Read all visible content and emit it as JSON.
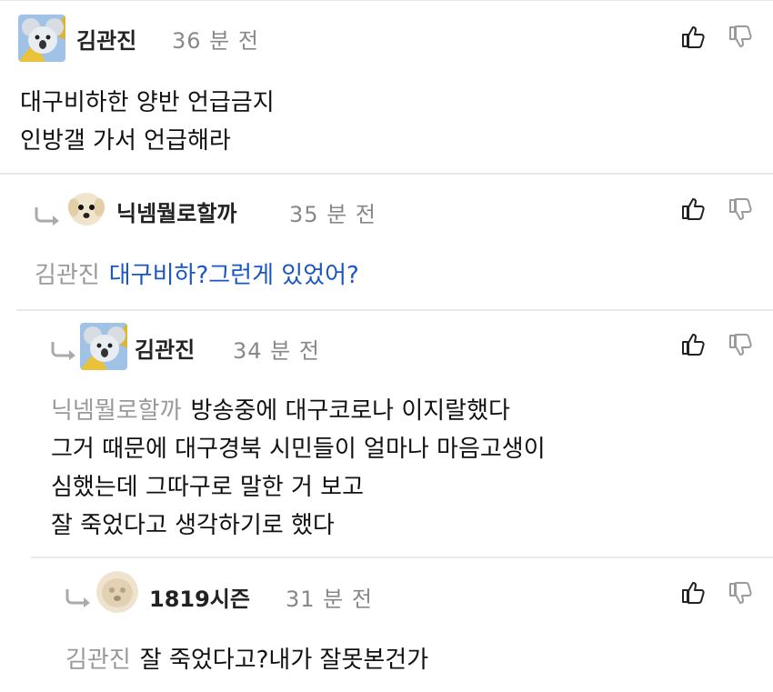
{
  "comments": [
    {
      "author": "김관진",
      "time": "36 분 전",
      "lines": [
        "대구비하한 양반 언급금지",
        "인방갤 가서 언급해라"
      ]
    },
    {
      "author": "닉넴뭘로할까",
      "time": "35 분 전",
      "mention": "김관진",
      "lines": [
        "대구비하?그런게 있었어?"
      ]
    },
    {
      "author": "김관진",
      "time": "34 분 전",
      "mention": "닉넴뭘로할까",
      "lines": [
        "방송중에 대구코로나 이지랄했다",
        "그거 때문에 대구경북 시민들이 얼마나 마음고생이",
        "심했는데 그따구로 말한 거 보고",
        "잘 죽었다고 생각하기로 했다"
      ]
    },
    {
      "author": "1819시즌",
      "time": "31 분 전",
      "mention": "김관진",
      "lines": [
        "잘 죽었다고?내가 잘못본건가"
      ]
    }
  ],
  "icons": {
    "like": "thumbs-up-icon",
    "dislike": "thumbs-down-icon",
    "reply": "reply-arrow-icon"
  },
  "colors": {
    "highlight": "#1a56c4",
    "muted": "#888888"
  }
}
